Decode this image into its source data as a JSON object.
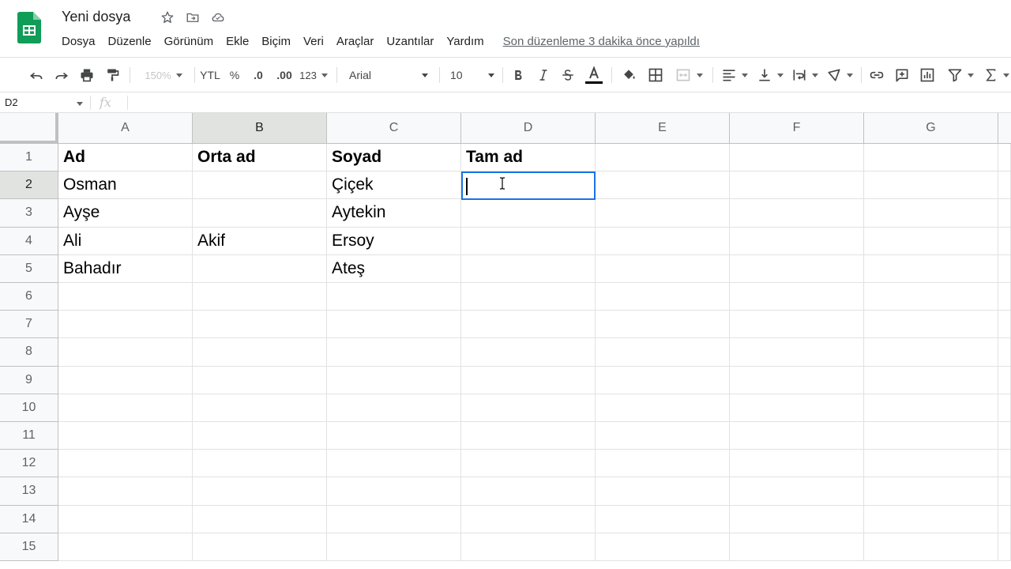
{
  "app": {
    "title": "Yeni dosya",
    "last_edit": "Son düzenleme 3 dakika önce yapıldı"
  },
  "menu": [
    "Dosya",
    "Düzenle",
    "Görünüm",
    "Ekle",
    "Biçim",
    "Veri",
    "Araçlar",
    "Uzantılar",
    "Yardım"
  ],
  "toolbar": {
    "zoom": "150%",
    "currency": "YTL",
    "percent": "%",
    "dec_less": ".0",
    "dec_more": ".00",
    "format_more": "123",
    "font": "Arial",
    "font_size": "10"
  },
  "formula_bar": {
    "name_box": "D2",
    "fx": "fx",
    "value": ""
  },
  "columns": [
    "A",
    "B",
    "C",
    "D",
    "E",
    "F",
    "G"
  ],
  "rows": [
    "1",
    "2",
    "3",
    "4",
    "5",
    "6",
    "7",
    "8",
    "9",
    "10",
    "11",
    "12",
    "13",
    "14",
    "15"
  ],
  "cells": [
    [
      "Ad",
      "Orta ad",
      "Soyad",
      "Tam ad",
      "",
      "",
      ""
    ],
    [
      "Osman",
      "",
      "Çiçek",
      "",
      "",
      "",
      ""
    ],
    [
      "Ayşe",
      "",
      "Aytekin",
      "",
      "",
      "",
      ""
    ],
    [
      "Ali",
      "Akif",
      "Ersoy",
      "",
      "",
      "",
      ""
    ],
    [
      "Bahadır",
      "",
      "Ateş",
      "",
      "",
      "",
      ""
    ]
  ],
  "selection": {
    "column": "B",
    "row": "2",
    "active_cell": "D2"
  },
  "colors": {
    "accent": "#1a73e8",
    "sheets_green": "#0f9d58"
  }
}
